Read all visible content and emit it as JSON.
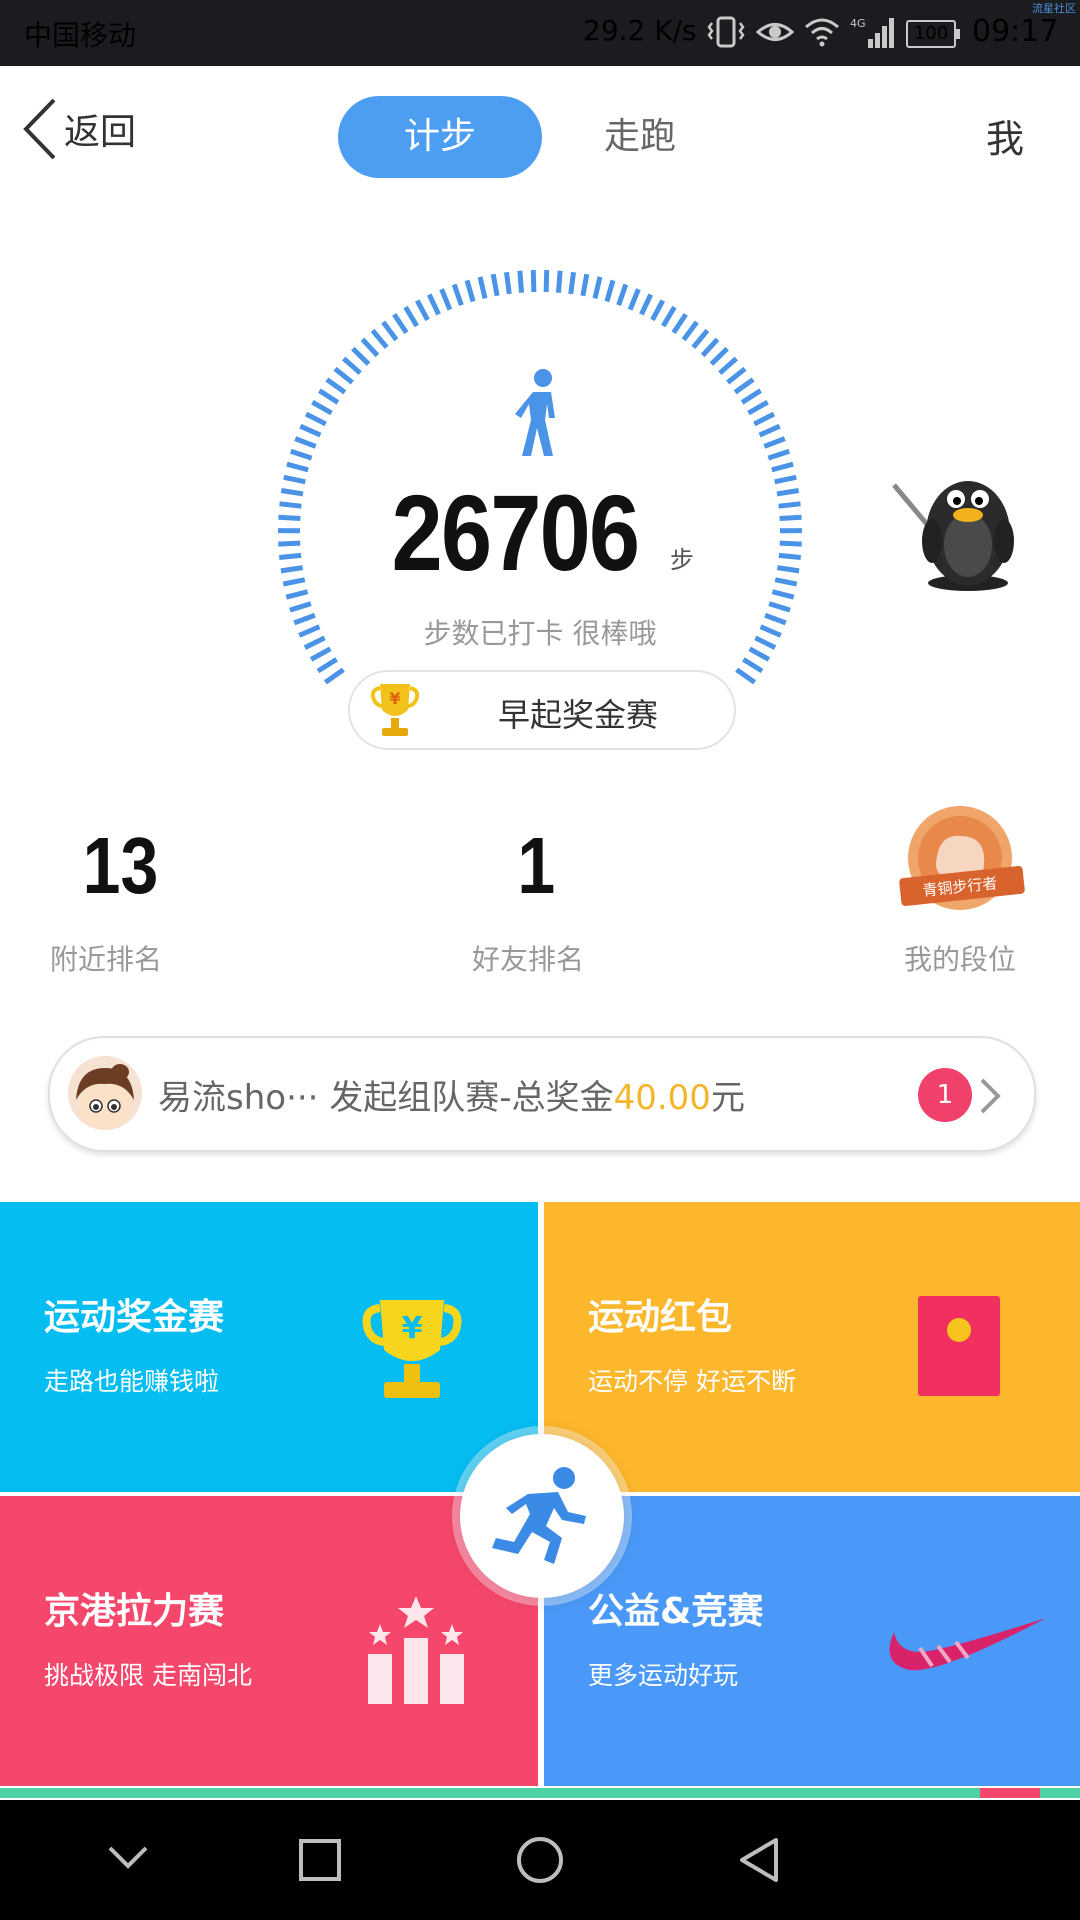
{
  "status_bar": {
    "carrier": "中国移动",
    "speed": "29.2 K/s",
    "network": "4G",
    "battery": "100",
    "time": "09:17",
    "watermark": "流星社区"
  },
  "header": {
    "back_label": "返回",
    "tabs": [
      {
        "label": "计步",
        "active": true
      },
      {
        "label": "走跑",
        "active": false
      }
    ],
    "me_label": "我"
  },
  "gauge": {
    "steps": "26706",
    "unit": "步",
    "checkin_text": "步数已打卡  很棒哦",
    "contest_label": "早起奖金赛",
    "trophy_glyph": "¥"
  },
  "ranks": [
    {
      "value": "13",
      "label": "附近排名"
    },
    {
      "value": "1",
      "label": "好友排名"
    },
    {
      "label": "我的段位",
      "badge_text": "青铜步行者"
    }
  ],
  "team_banner": {
    "user": "易流sho···",
    "text": "发起组队赛-总奖金",
    "amount": "40.00",
    "currency": "元",
    "count": "1"
  },
  "tiles": [
    {
      "title": "运动奖金赛",
      "subtitle": "走路也能赚钱啦",
      "icon": "trophy-icon",
      "color": "#06bdf2"
    },
    {
      "title": "运动红包",
      "subtitle": "运动不停 好运不断",
      "icon": "red-envelope-icon",
      "color": "#fcb72d"
    },
    {
      "title": "京港拉力赛",
      "subtitle": "挑战极限 走南闯北",
      "icon": "podium-icon",
      "color": "#f5476b"
    },
    {
      "title": "公益&竞赛",
      "subtitle": "更多运动好玩",
      "icon": "swoosh-icon",
      "color": "#4a98f7"
    }
  ],
  "colors": {
    "accent": "#4d9df1",
    "gauge": "#4a93e6",
    "amount": "#f5b52a"
  }
}
